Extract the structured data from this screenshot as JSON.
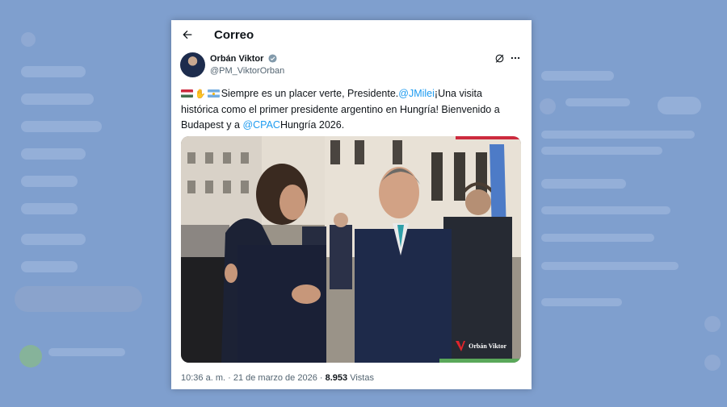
{
  "header": {
    "title": "Correo"
  },
  "tweet": {
    "author_name": "Orbán Viktor",
    "author_handle": "@PM_ViktorOrban",
    "text_part1": "Siempre es un placer verte, Presidente.",
    "mention1": "@JMilei",
    "text_part2": "¡Una visita histórica como el primer presidente argentino en Hungría! Bienvenido a Budapest y a",
    "mention2": "@CPAC",
    "text_part3": "Hungría 2026.",
    "photo_watermark": "Orbán Viktor",
    "time": "10:36 a. m.",
    "separator": "·",
    "date": "21 de marzo de 2026",
    "views_count": "8.953",
    "views_label": "Vistas"
  },
  "colors": {
    "accent": "#1d9bf0",
    "background": "#7f9fce",
    "verified": "#829aab"
  }
}
